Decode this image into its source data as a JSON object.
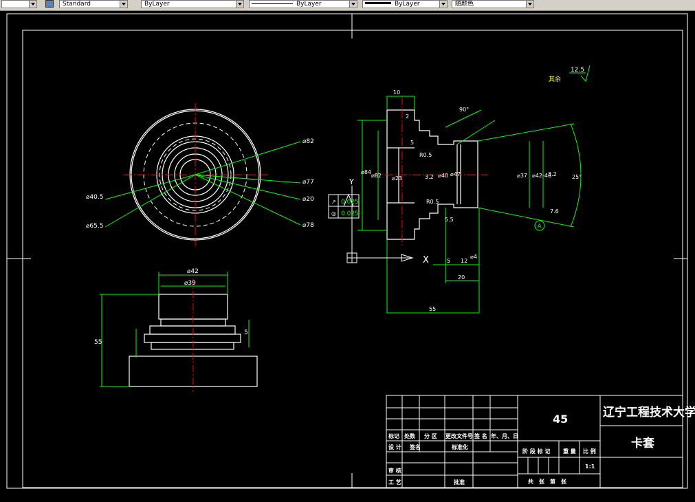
{
  "toolbar": {
    "textstyle": "Standard",
    "layer": "ByLayer",
    "linetype": "ByLayer",
    "lineweight": "ByLayer",
    "color": "随颜色"
  },
  "colors": {
    "background": "#000000",
    "frame": "#ffffff",
    "dim": "#00ff00",
    "center": "#ff0000",
    "title_text": "#ffffff"
  },
  "top_view": {
    "labels": [
      "⌀82",
      "⌀77",
      "⌀20",
      "⌀78",
      "⌀40.5",
      "⌀65.5"
    ]
  },
  "section_view": {
    "top_dims": [
      "10",
      "2",
      "90°",
      "5",
      "R0.5",
      "R0.5",
      "3.2",
      "5.5"
    ],
    "vertical_dims": [
      "⌀84",
      "⌀82",
      "⌀23",
      "⌀40",
      "⌀47",
      "⌀37",
      "⌀42-46",
      "⌀4"
    ],
    "right_dims": [
      "3.2",
      "7.6",
      "25°"
    ],
    "bottom_dims": [
      "5",
      "12",
      "20",
      "55"
    ],
    "tolerance_rows": [
      {
        "symbol": "↗",
        "value": "0.025"
      },
      {
        "symbol": "◎",
        "value": "0.025"
      }
    ],
    "datum": "A",
    "roughness_label": "其余",
    "roughness_value": "12.5"
  },
  "front_view": {
    "labels": [
      "⌀42",
      "⌀39",
      "55",
      "5"
    ]
  },
  "ucs": {
    "y": "Y",
    "x": "X"
  },
  "title_block": {
    "row_labels": [
      "标记",
      "处数",
      "分 区",
      "更改文件号",
      "签 名",
      "年、月、日"
    ],
    "design": "设 计",
    "standardize_sign": "签名",
    "standardization": "标准化",
    "review": "审 核",
    "process": "工 艺",
    "approve": "批准",
    "stage": "阶 段 标 记",
    "weight": "重 量",
    "scale_label": "比 例",
    "scale": "1:1",
    "sheet_total": "共　张　第　张",
    "material": "45",
    "school": "辽宁工程技术大学",
    "part": "卡套"
  }
}
